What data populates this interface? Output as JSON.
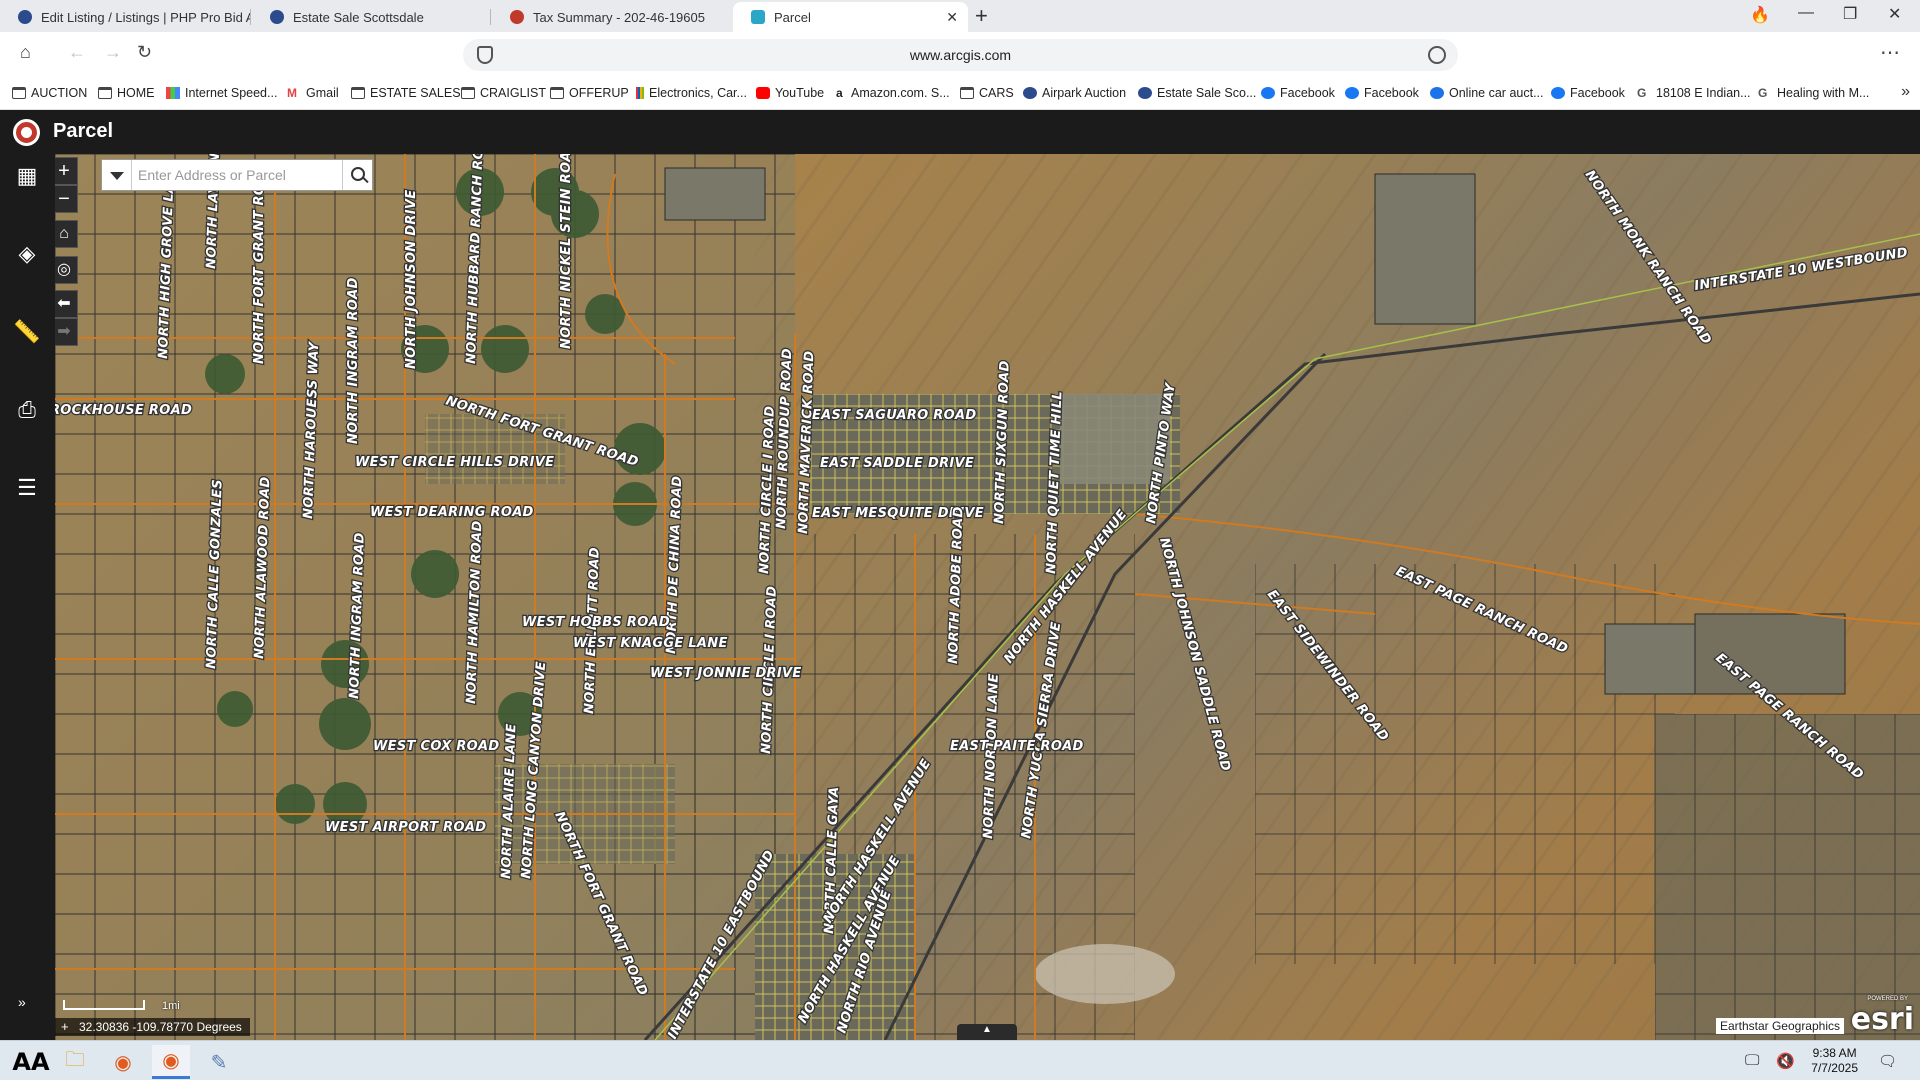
{
  "browser": {
    "tabs": [
      {
        "title": "Edit Listing / Listings | PHP Pro Bid A",
        "active": false
      },
      {
        "title": "Estate Sale Scottsdale",
        "active": false
      },
      {
        "title": "Tax Summary - 202-46-19605",
        "active": false
      },
      {
        "title": "Parcel",
        "active": true
      }
    ],
    "url": "www.arcgis.com",
    "bookmarks": [
      {
        "label": "AUCTION",
        "icon": "folder-icon"
      },
      {
        "label": "HOME",
        "icon": "folder-icon"
      },
      {
        "label": "Internet Speed...",
        "icon": "speedtest-icon"
      },
      {
        "label": "Gmail",
        "icon": "gmail-icon"
      },
      {
        "label": "ESTATE SALES",
        "icon": "folder-icon"
      },
      {
        "label": "CRAIGLIST",
        "icon": "folder-icon"
      },
      {
        "label": "OFFERUP",
        "icon": "folder-icon"
      },
      {
        "label": "Electronics, Car...",
        "icon": "ebay-icon"
      },
      {
        "label": "YouTube",
        "icon": "youtube-icon"
      },
      {
        "label": "Amazon.com. S...",
        "icon": "amazon-icon"
      },
      {
        "label": "CARS",
        "icon": "folder-icon"
      },
      {
        "label": "Airpark Auction",
        "icon": "site-icon"
      },
      {
        "label": "Estate Sale Sco...",
        "icon": "site-icon"
      },
      {
        "label": "Facebook",
        "icon": "facebook-icon"
      },
      {
        "label": "Facebook",
        "icon": "facebook-icon"
      },
      {
        "label": "Online car auct...",
        "icon": "site-icon"
      },
      {
        "label": "Facebook",
        "icon": "facebook-icon"
      },
      {
        "label": "18108 E Indian...",
        "icon": "google-icon"
      },
      {
        "label": "Healing with M...",
        "icon": "google-icon"
      }
    ]
  },
  "app": {
    "title": "Parcel",
    "search_placeholder": "Enter Address or Parcel",
    "scale_label": "1mi",
    "coordinates": "32.30836 -109.78770 Degrees",
    "attribution": "Earthstar Geographics",
    "esri_logo": "esri",
    "esri_powered": "POWERED BY"
  },
  "map": {
    "road_labels": [
      "NORTH HIGH GROVE LANE",
      "NORTH LAYTON",
      "NORTH FORT GRANT ROAD",
      "NORTH INGRAM ROAD",
      "NORTH JOHNSON DRIVE",
      "NORTH HUBBARD RANCH ROAD",
      "NORTH NICKEL STEIN ROAD",
      "NORTH HAROUESS WAY",
      "ROCKHOUSE ROAD",
      "NORTH FORT GRANT ROAD",
      "WEST CIRCLE HILLS DRIVE",
      "WEST DEARING ROAD",
      "EAST SAGUARO ROAD",
      "EAST SADDLE DRIVE",
      "EAST MESQUITE DRIVE",
      "NORTH ROUNDUP ROAD",
      "NORTH MAVERICK ROAD",
      "NORTH SIXGUN ROAD",
      "NORTH QUIET TIME HILL",
      "NORTH PINTO WAY",
      "NORTH CIRCLE I ROAD",
      "NORTH ADOBE ROAD",
      "NORTH HASKELL AVENUE",
      "NORTH JOHNSON SADDLE ROAD",
      "EAST SIDEWINDER ROAD",
      "EAST PAGE RANCH ROAD",
      "EAST PAGE RANCH ROAD",
      "INTERSTATE 10 WESTBOUND",
      "NORTH MONK RANCH ROAD",
      "NORTH CALLE GONZALES",
      "NORTH ALAWOOD ROAD",
      "NORTH INGRAM ROAD",
      "NORTH HAMILTON ROAD",
      "NORTH ELLIOTT ROAD",
      "NORTH DE CHINA ROAD",
      "NORTH CIRCLE I ROAD",
      "NORTH YUCCA SIERRA DRIVE",
      "NORTH NORTON LANE",
      "WEST HOBBS ROAD",
      "WEST KNAGGE LANE",
      "WEST JONNIE DRIVE",
      "NORTH ALAIRE LANE",
      "NORTH LONG CANYON DRIVE",
      "NORTH FORT GRANT ROAD",
      "NORTH CALLE GAYA",
      "NORTH HASKELL AVENUE",
      "WEST COX ROAD",
      "EAST PAITE ROAD",
      "WEST AIRPORT ROAD",
      "INTERSTATE 10 EASTBOUND",
      "NORTH HASKELL AVENUE",
      "NORTH RIO AVENUE"
    ]
  },
  "taskbar": {
    "time": "9:38 AM",
    "date": "7/7/2025"
  }
}
